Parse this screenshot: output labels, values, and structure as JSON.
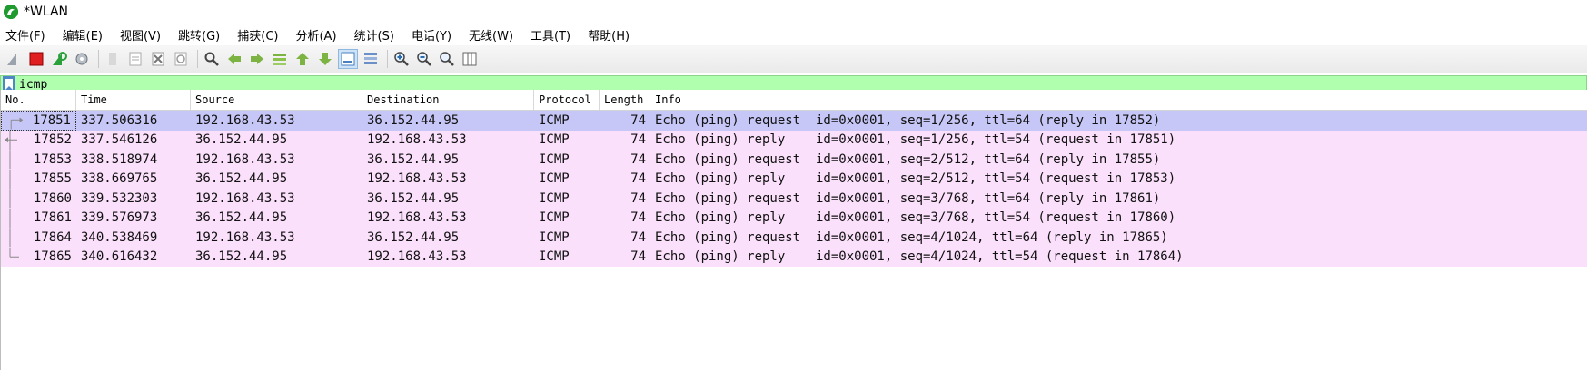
{
  "window": {
    "title": "*WLAN",
    "logo_text": ""
  },
  "menu": [
    "文件(F)",
    "编辑(E)",
    "视图(V)",
    "跳转(G)",
    "捕获(C)",
    "分析(A)",
    "统计(S)",
    "电话(Y)",
    "无线(W)",
    "工具(T)",
    "帮助(H)"
  ],
  "toolbar": {
    "icons": [
      "shark-fin-start-icon",
      "stop-capture-icon",
      "restart-capture-icon",
      "capture-options-icon",
      "open-file-icon",
      "save-file-icon",
      "close-file-icon",
      "reload-file-icon",
      "find-packet-icon",
      "go-back-icon",
      "go-forward-icon",
      "go-to-packet-icon",
      "go-first-icon",
      "go-last-icon",
      "autoscroll-icon",
      "colorize-icon",
      "zoom-in-icon",
      "zoom-out-icon",
      "normal-size-icon",
      "resize-columns-icon"
    ]
  },
  "filter": {
    "value": "icmp"
  },
  "columns": [
    "No.",
    "Time",
    "Source",
    "Destination",
    "Protocol",
    "Length",
    "Info"
  ],
  "packets": [
    {
      "no": "17851",
      "time": "337.506316",
      "src": "192.168.43.53",
      "dst": "36.152.44.95",
      "proto": "ICMP",
      "len": "74",
      "info": "Echo (ping) request  id=0x0001, seq=1/256, ttl=64 (reply in 17852)",
      "kind": "request"
    },
    {
      "no": "17852",
      "time": "337.546126",
      "src": "36.152.44.95",
      "dst": "192.168.43.53",
      "proto": "ICMP",
      "len": "74",
      "info": "Echo (ping) reply    id=0x0001, seq=1/256, ttl=54 (request in 17851)",
      "kind": "reply"
    },
    {
      "no": "17853",
      "time": "338.518974",
      "src": "192.168.43.53",
      "dst": "36.152.44.95",
      "proto": "ICMP",
      "len": "74",
      "info": "Echo (ping) request  id=0x0001, seq=2/512, ttl=64 (reply in 17855)",
      "kind": "request"
    },
    {
      "no": "17855",
      "time": "338.669765",
      "src": "36.152.44.95",
      "dst": "192.168.43.53",
      "proto": "ICMP",
      "len": "74",
      "info": "Echo (ping) reply    id=0x0001, seq=2/512, ttl=54 (request in 17853)",
      "kind": "reply"
    },
    {
      "no": "17860",
      "time": "339.532303",
      "src": "192.168.43.53",
      "dst": "36.152.44.95",
      "proto": "ICMP",
      "len": "74",
      "info": "Echo (ping) request  id=0x0001, seq=3/768, ttl=64 (reply in 17861)",
      "kind": "request"
    },
    {
      "no": "17861",
      "time": "339.576973",
      "src": "36.152.44.95",
      "dst": "192.168.43.53",
      "proto": "ICMP",
      "len": "74",
      "info": "Echo (ping) reply    id=0x0001, seq=3/768, ttl=54 (request in 17860)",
      "kind": "reply"
    },
    {
      "no": "17864",
      "time": "340.538469",
      "src": "192.168.43.53",
      "dst": "36.152.44.95",
      "proto": "ICMP",
      "len": "74",
      "info": "Echo (ping) request  id=0x0001, seq=4/1024, ttl=64 (reply in 17865)",
      "kind": "request"
    },
    {
      "no": "17865",
      "time": "340.616432",
      "src": "36.152.44.95",
      "dst": "192.168.43.53",
      "proto": "ICMP",
      "len": "74",
      "info": "Echo (ping) reply    id=0x0001, seq=4/1024, ttl=54 (request in 17864)",
      "kind": "reply"
    }
  ],
  "selected_index": 0,
  "colors": {
    "selected": "#c6c6f7",
    "icmp": "#fbe0fb",
    "filter_ok": "#afffaf"
  }
}
